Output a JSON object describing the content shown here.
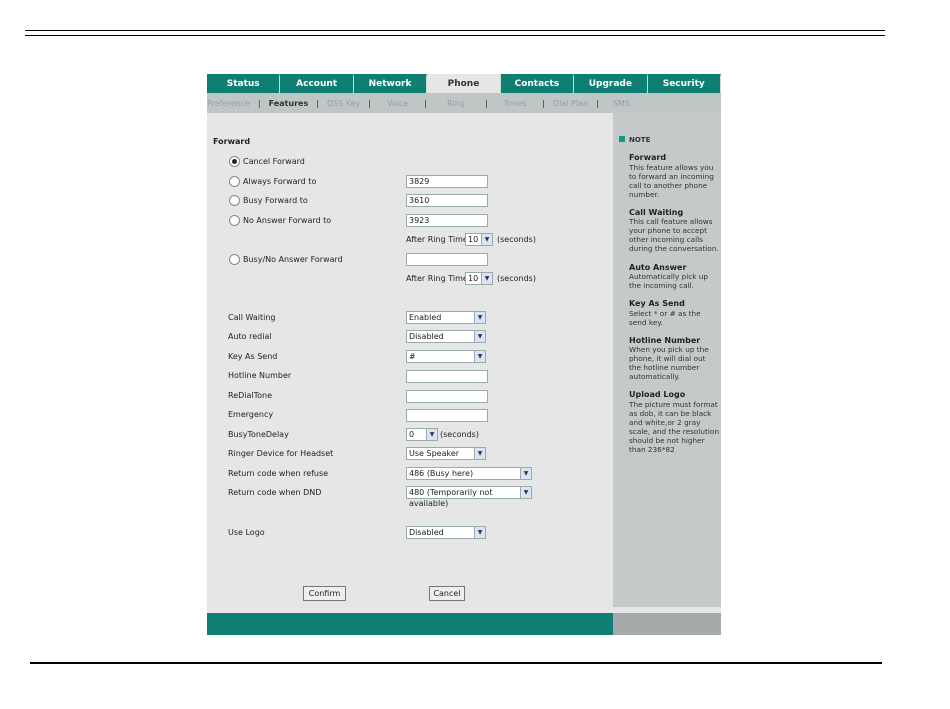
{
  "tabs": [
    "Status",
    "Account",
    "Network",
    "Phone",
    "Contacts",
    "Upgrade",
    "Security"
  ],
  "active_tab": "Phone",
  "subnav": [
    "Preference",
    "Features",
    "DSS Key",
    "Voice",
    "Ring",
    "Tones",
    "Dial Plan",
    "SMS"
  ],
  "active_subnav": "Features",
  "forward": {
    "section_title": "Forward",
    "cancel_label": "Cancel Forward",
    "always_label": "Always Forward to",
    "always_value": "3829",
    "busy_label": "Busy Forward to",
    "busy_value": "3610",
    "no_answer_label": "No Answer Forward to",
    "no_answer_value": "3923",
    "after_ring_label": "After Ring Time",
    "after_ring_value": "10",
    "seconds": "(seconds)",
    "busy_no_answer_label": "Busy/No Answer Forward",
    "busy_no_answer_value": "",
    "after_ring_value_2": "10"
  },
  "settings": {
    "call_waiting_label": "Call Waiting",
    "call_waiting_value": "Enabled",
    "auto_redial_label": "Auto redial",
    "auto_redial_value": "Disabled",
    "key_as_send_label": "Key As Send",
    "key_as_send_value": "#",
    "hotline_label": "Hotline Number",
    "redial_tone_label": "ReDialTone",
    "emergency_label": "Emergency",
    "busy_tone_delay_label": "BusyToneDelay",
    "busy_tone_delay_value": "0",
    "ringer_device_label": "Ringer Device for Headset",
    "ringer_device_value": "Use Speaker",
    "return_refuse_label": "Return code when refuse",
    "return_refuse_value": "486 (Busy here)",
    "return_dnd_label": "Return code when DND",
    "return_dnd_value": "480 (Temporarily not available)",
    "use_logo_label": "Use Logo",
    "use_logo_value": "Disabled"
  },
  "buttons": {
    "confirm": "Confirm",
    "cancel": "Cancel"
  },
  "note": {
    "title": "NOTE",
    "items": [
      {
        "h": "Forward",
        "p": "This feature allows you to forward an incoming call to another phone number."
      },
      {
        "h": "Call Waiting",
        "p": "This call feature allows your phone to accept other incoming calls during the conversation."
      },
      {
        "h": "Auto Answer",
        "p": "Automatically pick up the incoming call."
      },
      {
        "h": "Key As Send",
        "p": "Select * or # as the send key."
      },
      {
        "h": "Hotline Number",
        "p": "When you pick up the phone, it will dial out the hotline number automatically."
      },
      {
        "h": "Upload Logo",
        "p": "The picture must format as dob, it can be black and white,or 2 gray scale, and the resolution should be not higher than 236*82"
      }
    ]
  },
  "colors": {
    "teal": "#0f7f74",
    "panel": "#e6e6e6",
    "sidebar": "#c6c9c9"
  }
}
